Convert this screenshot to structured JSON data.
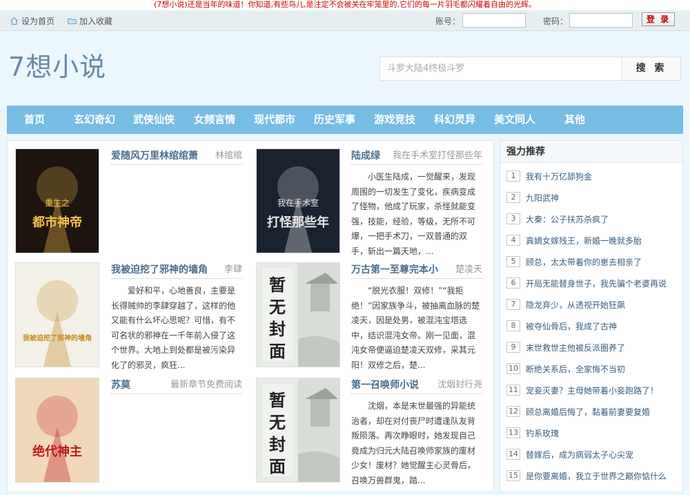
{
  "notice": "(7想小说)还是当年的味道！你知道,有些鸟儿,是注定不会被关在牢笼里的,它们的每一片羽毛都闪耀着自由的光辉。",
  "topbar": {
    "set_home": "设为首页",
    "add_favorite": "加入收藏",
    "account_label": "账号：",
    "password_label": "密码：",
    "login_button": "登 录"
  },
  "logo": "7想小说",
  "search": {
    "placeholder": "斗罗大陆4终极斗罗",
    "button": "搜 索"
  },
  "nav": [
    "首页",
    "玄幻奇幻",
    "武侠仙侠",
    "女频言情",
    "现代都市",
    "历史军事",
    "游戏竞技",
    "科幻灵异",
    "美文同人",
    "其他"
  ],
  "books": [
    {
      "title": "爱随风万里林绾绾萧",
      "author": "林绾绾",
      "desc": "",
      "cover": {
        "text": "都市神帝",
        "subtext": "重生之",
        "bg": "#1e1410",
        "accent": "#f6c14a"
      }
    },
    {
      "title": "陆成绿",
      "author": "我在手术室打怪那些年",
      "desc": "小医生陆成，一觉醒来，发现周围的一切发生了变化，疾病变成了怪物，他成了玩家，杀怪就能变强，技能，经验，等级，无所不可爆，一把手术刀，一双普通的双手，斩出一篇天地，...",
      "cover": {
        "text": "打怪那些年",
        "subtext": "我在手术室",
        "bg": "#1a2230",
        "accent": "#e8e8e8"
      }
    },
    {
      "title": "我被迫挖了邪神的墙角",
      "author": "李肆",
      "desc": "爱好和平，心地善良，主要是长得贼帅的李肆穿越了，这样的他又能有什么坏心思呢？可惜，有不可名状的邪神在一千年前入侵了这个世界。大地上到处都是被污染异化了的邪灵，疯狂...",
      "cover": {
        "text": "我被迫挖了邪神的墙角",
        "subtext": "",
        "bg": "#f3f0e8",
        "accent": "#c48a1a"
      }
    },
    {
      "title": "万古第一至尊完本小",
      "author": "楚凌天",
      "desc": "“脱光衣服！双修！”“我拒绝！”因家族争斗，被抽离血脉的楚凌天，因是处男，被混沌宝塔选中，结识混沌女帝。刚一见面，混沌女帝便逼迫楚凌天双修，采其元阳！双修之后，楚...",
      "cover": {
        "text": "暂无封面",
        "subtext": "",
        "bg": "#e7ebe6",
        "accent": "#222"
      }
    },
    {
      "title": "苏莫",
      "author": "最新章节免费阅读",
      "desc": "",
      "cover": {
        "text": "绝代神主",
        "subtext": "",
        "bg": "#f0d8b8",
        "accent": "#c0181a"
      }
    },
    {
      "title": "第一召唤师小说",
      "author": "沈烟封行尧",
      "desc": "沈烟，本是末世最强的异能统治者，却在对付丧尸时遭逢队友背叛陨落。再次睁眼时，她发现自己竟成为归元大陆召唤师家族的废材少女！废材？她觉醒主心灵骨后，召唤万兽群鬼，踏...",
      "cover": {
        "text": "暂无封面",
        "subtext": "",
        "bg": "#e7ebe6",
        "accent": "#222"
      }
    }
  ],
  "sidebar": {
    "title": "强力推荐",
    "items": [
      {
        "num": "1",
        "title": "我有十万亿舔狗金"
      },
      {
        "num": "2",
        "title": "九阳武神"
      },
      {
        "num": "3",
        "title": "大秦：公子扶苏杀疯了"
      },
      {
        "num": "4",
        "title": "真嫡女嫁残王，新婚一晚就多胎"
      },
      {
        "num": "5",
        "title": "顾总，太太带着你的崽去相亲了"
      },
      {
        "num": "6",
        "title": "开局无能替身世子，我先骗个老婆再说"
      },
      {
        "num": "7",
        "title": "隐龙弃少，从透视开始狂飙"
      },
      {
        "num": "8",
        "title": "被夺仙骨后，我成了古神"
      },
      {
        "num": "9",
        "title": "末世救世主他被反派圈养了"
      },
      {
        "num": "10",
        "title": "断绝关系后，全家悔不当初"
      },
      {
        "num": "11",
        "title": "宠妾灭妻？主母她带着小妾跑路了！"
      },
      {
        "num": "12",
        "title": "顾总离婚后悔了，黏着前妻要复婚"
      },
      {
        "num": "13",
        "title": "钓系玫瑰"
      },
      {
        "num": "14",
        "title": "替嫁后，成为病弱太子心尖宠"
      },
      {
        "num": "15",
        "title": "是你要离婚，我立于世界之巅你惦什么"
      }
    ]
  }
}
